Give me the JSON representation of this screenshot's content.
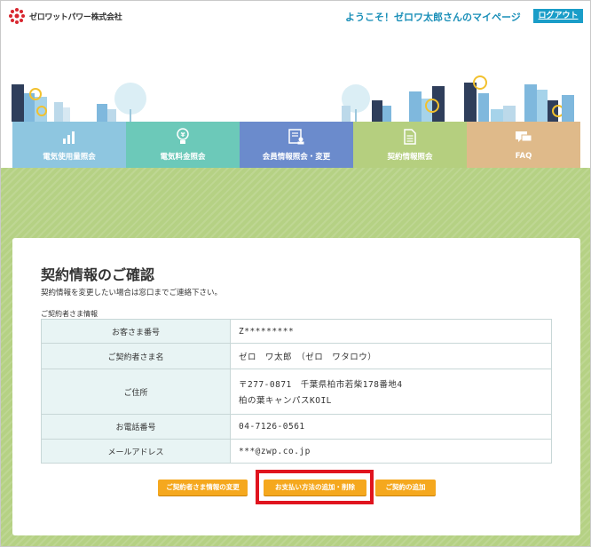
{
  "header": {
    "logo_text": "ゼロワットパワー株式会社",
    "welcome": "ようこそ！ゼロワ太郎さんのマイページ",
    "logout_label": "ログアウト"
  },
  "nav": {
    "items": [
      {
        "label": "電気使用量照会",
        "icon": "bar-chart-icon"
      },
      {
        "label": "電気料金照会",
        "icon": "lightbulb-yen-icon"
      },
      {
        "label": "会員情報照会・変更",
        "icon": "member-card-icon"
      },
      {
        "label": "契約情報照会",
        "icon": "document-icon"
      },
      {
        "label": "FAQ",
        "icon": "speech-bubble-icon"
      }
    ]
  },
  "main": {
    "title": "契約情報のご確認",
    "note": "契約情報を変更したい場合は窓口までご連絡下さい。",
    "section_label": "ご契約者さま情報",
    "rows": [
      {
        "label": "お客さま番号",
        "value": "Z*********"
      },
      {
        "label": "ご契約者さま名",
        "value": "ゼロ　ワ太郎　（ゼロ　ワタロウ）"
      },
      {
        "label": "ご住所",
        "value": "〒277-0871　千葉県柏市若柴178番地4",
        "value2": "柏の葉キャンパスKOIL"
      },
      {
        "label": "お電話番号",
        "value": "04-7126-0561"
      },
      {
        "label": "メールアドレス",
        "value": "***@zwp.co.jp"
      }
    ],
    "buttons": {
      "change_contractor": "ご契約者さま情報の変更",
      "payment_method": "お支払い方法の追加・削除",
      "add_contract": "ご契約の追加"
    }
  },
  "colors": {
    "accent_blue": "#1a9dc8",
    "button_orange": "#f5a81e",
    "highlight_red": "#e0141e",
    "nav_usage": "#8ec6e0",
    "nav_fee": "#6cc9b9",
    "nav_member": "#6b8bcc",
    "nav_contract": "#b5cf7f",
    "nav_faq": "#dfba8a"
  }
}
